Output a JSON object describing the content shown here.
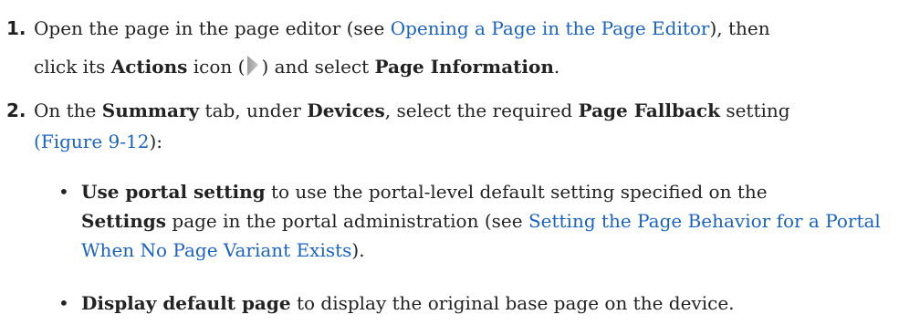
{
  "steps": [
    {
      "number": "1.",
      "line1_text": "Open the page in the page editor (see ",
      "line1_link": "Opening a Page in the Page Editor",
      "line1_after": "), then",
      "line2_pre": "click its ",
      "line2_bold1": "Actions",
      "line2_mid1": " icon (",
      "actions_icon": "actions-triangle-icon",
      "line2_mid2": ") and select ",
      "line2_bold2": "Page Information",
      "line2_end": "."
    },
    {
      "number": "2.",
      "t1": "On the ",
      "b1": "Summary",
      "t2": " tab, under ",
      "b2": "Devices",
      "t3": ", select the required ",
      "b3": "Page Fallback",
      "t4": " setting",
      "link_open": "(",
      "link": "Figure 9-12",
      "link_close": "):"
    }
  ],
  "bullets": [
    {
      "marker": "•",
      "bold": "Use portal setting",
      "t1": " to use the portal-level default setting specified on the",
      "bold2": "Settings",
      "t2": " page in the portal administration (see ",
      "link": "Setting the Page Behavior for a Portal When No Page Variant Exists",
      "t3": ")."
    },
    {
      "marker": "•",
      "bold": "Display default page",
      "t1": " to display the original base page on the device."
    }
  ],
  "colors": {
    "link": "#1a63c6",
    "text": "#222222"
  }
}
